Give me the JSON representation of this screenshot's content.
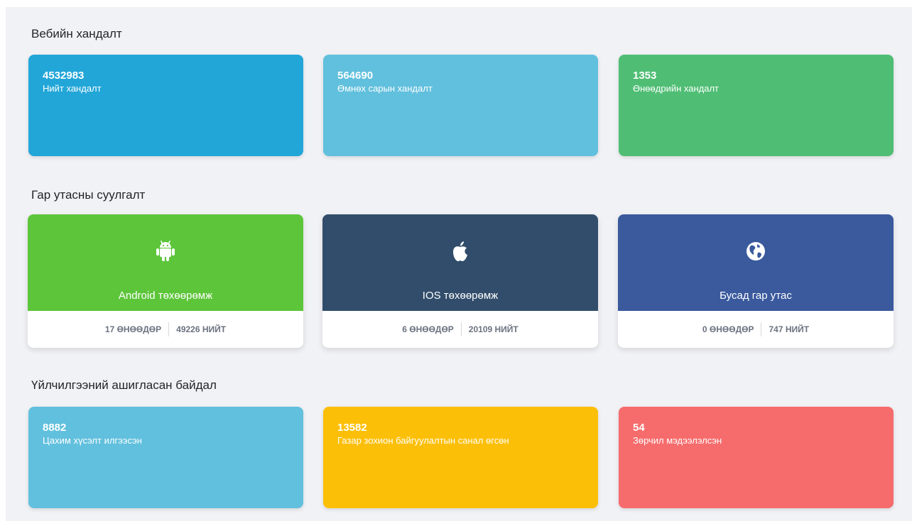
{
  "colors": {
    "background": "#f1f2f6",
    "blue": "#22a6d8",
    "light_blue": "#61c0dd",
    "green": "#4fbe74",
    "android_green": "#5dc53a",
    "ios_navy": "#314d6b",
    "other_blue": "#3a5a9d",
    "yellow": "#fcbf08",
    "red": "#f66c6c"
  },
  "web_visits": {
    "title": "Вебийн хандалт",
    "cards": [
      {
        "value": "4532983",
        "label": "Нийт хандалт"
      },
      {
        "value": "564690",
        "label": "Өмнөх сарын хандалт"
      },
      {
        "value": "1353",
        "label": "Өнөөдрийн хандалт"
      }
    ]
  },
  "mobile_installs": {
    "title": "Гар утасны суулгалт",
    "cards": [
      {
        "icon": "android-icon",
        "title": "Android төхөөрөмж",
        "today": "17 ӨНӨӨДӨР",
        "total": "49226 НИЙТ"
      },
      {
        "icon": "apple-icon",
        "title": "IOS төхөөрөмж",
        "today": "6 ӨНӨӨДӨР",
        "total": "20109 НИЙТ"
      },
      {
        "icon": "globe-icon",
        "title": "Бусад гар утас",
        "today": "0 ӨНӨӨДӨР",
        "total": "747 НИЙТ"
      }
    ]
  },
  "service_usage": {
    "title": "Үйлчилгээний ашигласан байдал",
    "cards": [
      {
        "value": "8882",
        "label": "Цахим хүсэлт илгээсэн"
      },
      {
        "value": "13582",
        "label": "Газар зохион байгуулалтын санал өгсөн"
      },
      {
        "value": "54",
        "label": "Зөрчил мэдээлэлсэн"
      }
    ]
  }
}
